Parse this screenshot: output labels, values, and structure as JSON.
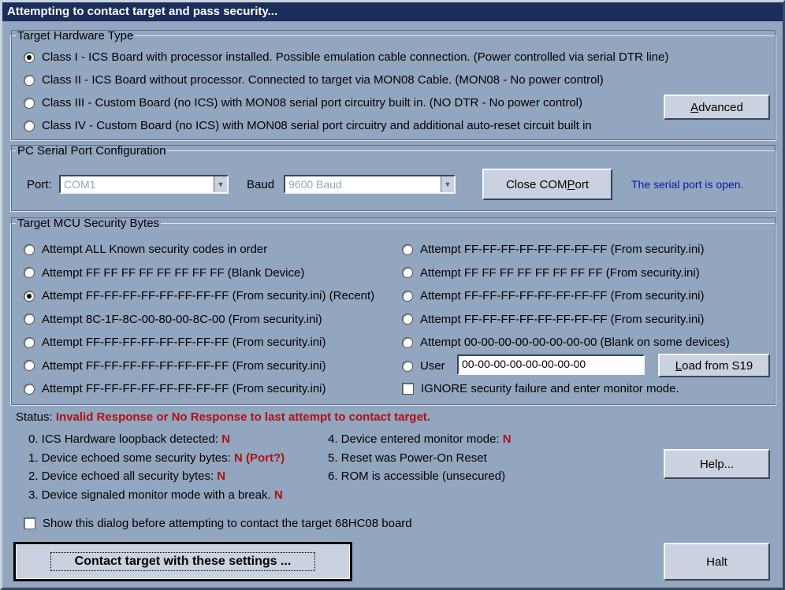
{
  "title": "Attempting to contact target and pass security...",
  "hardware": {
    "legend": "Target Hardware Type",
    "options": [
      {
        "label": "Class I - ICS Board with processor installed. Possible emulation cable connection. (Power controlled via serial DTR line)",
        "checked": true
      },
      {
        "label": "Class II - ICS Board without processor. Connected to target via MON08 Cable. (MON08 - No power control)",
        "checked": false
      },
      {
        "label": "Class III - Custom Board (no ICS) with MON08 serial port circuitry built in. (NO DTR - No power control)",
        "checked": false
      },
      {
        "label": "Class IV - Custom Board (no ICS) with MON08 serial port circuitry and additional auto-reset circuit built in",
        "checked": false
      }
    ],
    "advanced_button": {
      "pre": "",
      "u": "A",
      "post": "dvanced"
    }
  },
  "serial": {
    "legend": "PC Serial Port Configuration",
    "port_label": "Port:",
    "port_value": "COM1",
    "baud_label": "Baud",
    "baud_value": "9600 Baud",
    "close_button": {
      "pre": "Close COM ",
      "u": "P",
      "post": "ort"
    },
    "status_text": "The serial port is open."
  },
  "security": {
    "legend": "Target MCU Security Bytes",
    "left_options": [
      {
        "label": "Attempt ALL Known security codes in order",
        "checked": false
      },
      {
        "label": "Attempt FF FF FF FF FF FF FF FF (Blank Device)",
        "checked": false
      },
      {
        "label": "Attempt FF-FF-FF-FF-FF-FF-FF-FF (From security.ini) (Recent)",
        "checked": true
      },
      {
        "label": "Attempt 8C-1F-8C-00-80-00-8C-00 (From security.ini)",
        "checked": false
      },
      {
        "label": "Attempt FF-FF-FF-FF-FF-FF-FF-FF (From security.ini)",
        "checked": false
      },
      {
        "label": "Attempt FF-FF-FF-FF-FF-FF-FF-FF (From security.ini)",
        "checked": false
      },
      {
        "label": "Attempt FF-FF-FF-FF-FF-FF-FF-FF (From security.ini)",
        "checked": false
      }
    ],
    "right_options": [
      {
        "label": "Attempt FF-FF-FF-FF-FF-FF-FF-FF (From security.ini)",
        "checked": false
      },
      {
        "label": "Attempt FF FF FF FF FF FF FF FF (From security.ini)",
        "checked": false
      },
      {
        "label": "Attempt FF-FF-FF-FF-FF-FF-FF-FF (From security.ini)",
        "checked": false
      },
      {
        "label": "Attempt FF-FF-FF-FF-FF-FF-FF-FF (From security.ini)",
        "checked": false
      },
      {
        "label": "Attempt 00-00-00-00-00-00-00-00 (Blank on some devices)",
        "checked": false
      }
    ],
    "user_label": "User",
    "user_value": "00-00-00-00-00-00-00-00",
    "load_button": {
      "pre": "",
      "u": "L",
      "post": "oad from S19"
    },
    "ignore_label": "IGNORE security failure and enter monitor mode."
  },
  "status": {
    "label": "Status:",
    "message": "Invalid Response or No Response to last attempt to contact target.",
    "items_left": [
      {
        "text": "0. ICS Hardware loopback detected:",
        "flag": "N"
      },
      {
        "text": "1. Device echoed some security bytes:",
        "flag": "N (Port?)"
      },
      {
        "text": "2. Device echoed all security bytes:",
        "flag": "N"
      },
      {
        "text": "3. Device signaled monitor mode with a break.",
        "flag": "N"
      }
    ],
    "items_right": [
      {
        "text": "4. Device entered monitor mode:",
        "flag": "N"
      },
      {
        "text": "5. Reset was Power-On Reset",
        "flag": ""
      },
      {
        "text": "6. ROM is accessible (unsecured)",
        "flag": ""
      }
    ],
    "help_button": "Help...",
    "show_dialog_label": "Show this dialog before attempting to contact the target 68HC08 board"
  },
  "contact_button": "Contact target with these settings ...",
  "halt_button": "Halt",
  "colors": {
    "title_bg": "#1b2e5a",
    "bg": "#92a6c0",
    "status_red": "#b01010",
    "serial_status": "#0a1aa0"
  }
}
